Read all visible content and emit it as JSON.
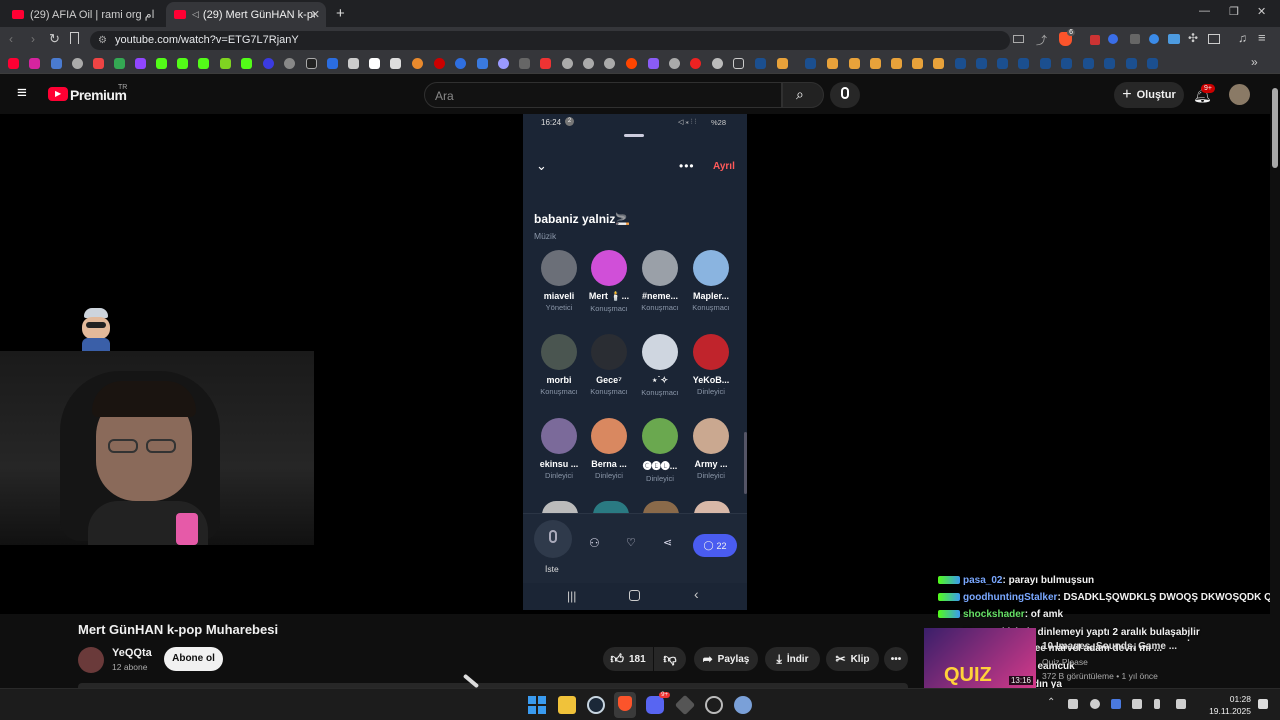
{
  "browser": {
    "tabs": [
      {
        "title": "(29) AFIA Oil | rami org تقطيع اعدام -",
        "active": false
      },
      {
        "title": "(29) Mert GünHAN k-pop Mu",
        "active": true
      }
    ],
    "url": "youtube.com/watch?v=ETG7L7RjanY",
    "ext_badge": "6"
  },
  "youtube": {
    "logo_text": "Premium",
    "region": "TR",
    "search_placeholder": "Ara",
    "create_label": "Oluştur",
    "notif_count": "9+"
  },
  "phone": {
    "time": "16:24",
    "status_badge": "2",
    "battery": "%28",
    "leave_label": "Ayrıl",
    "room_title": "babaniz yalniz🚬",
    "room_category": "Müzik",
    "members": [
      {
        "name": "miaveli",
        "role": "Yönetici",
        "color": "#6b6f78"
      },
      {
        "name": "Mert 🕯️...",
        "role": "Konuşmacı",
        "color": "#d04fd8"
      },
      {
        "name": "#neme...",
        "role": "Konuşmacı",
        "color": "#9aa0a8"
      },
      {
        "name": "Mapler...",
        "role": "Konuşmacı",
        "color": "#8ab4e0"
      },
      {
        "name": "morbi",
        "role": "Konuşmacı",
        "color": "#4a5550"
      },
      {
        "name": "Gece⁷",
        "role": "Konuşmacı",
        "color": "#2a2d33"
      },
      {
        "name": "⋆˙✧",
        "role": "Konuşmacı",
        "color": "#cfd6e0"
      },
      {
        "name": "YeKoB...",
        "role": "Dinleyici",
        "color": "#c0242c"
      },
      {
        "name": "ekinsu ...",
        "role": "Dinleyici",
        "color": "#7b6a9a"
      },
      {
        "name": "Berna ...",
        "role": "Dinleyici",
        "color": "#d98860"
      },
      {
        "name": "🅒🅔🅛...",
        "role": "Dinleyici",
        "color": "#6aa84f"
      },
      {
        "name": "Army ...",
        "role": "Dinleyici",
        "color": "#caa890"
      }
    ],
    "listen_label": "İste",
    "chat_count": "22"
  },
  "overlay_chat": [
    {
      "user": "pasa_02",
      "msg": ": parayı bulmuşsun",
      "color": "#7aa8ff"
    },
    {
      "user": "goodhuntingStalker",
      "msg": ": DSADKLŞQWDKLŞ DWOQŞ DKWOŞQDK Q",
      "color": "#7aa8ff"
    },
    {
      "user": "shockshader",
      "msg": ": of amk",
      "color": "#66e066"
    },
    {
      "user": "Newgp",
      "msg": ": kizimiz dinlemeyi yaptı 2 aralık bulaşabilir",
      "color": "#7aa8ff"
    },
    {
      "user": "pasa_02",
      "msg": ": stan lee marvel adam devri mi ...",
      "color": "#d080ff"
    },
    {
      "user": "KadimSovalye",
      "msg": ": eamcuk",
      "color": "#7aa8ff"
    },
    {
      "user": "",
      "msg": "ya ne anlatıyo bu kadın ya",
      "color": "#ffffff"
    }
  ],
  "endcard": {
    "title": "10 Images, Sounds, Game ...",
    "channel": "Quiz Please",
    "meta": "372 B görüntüleme • 1 yıl önce",
    "duration": "13:16",
    "thumb_text": "QUIZ"
  },
  "video": {
    "title": "Mert GünHAN k-pop Muharebesi",
    "channel": "YeQQta",
    "subs": "12 abone",
    "subscribe_label": "Abone ol",
    "likes": "181",
    "share_label": "Paylaş",
    "download_label": "İndir",
    "clip_label": "Klip"
  },
  "taskbar": {
    "time": "01:28",
    "date": "19.11.2025",
    "discord_badge": "9+"
  }
}
